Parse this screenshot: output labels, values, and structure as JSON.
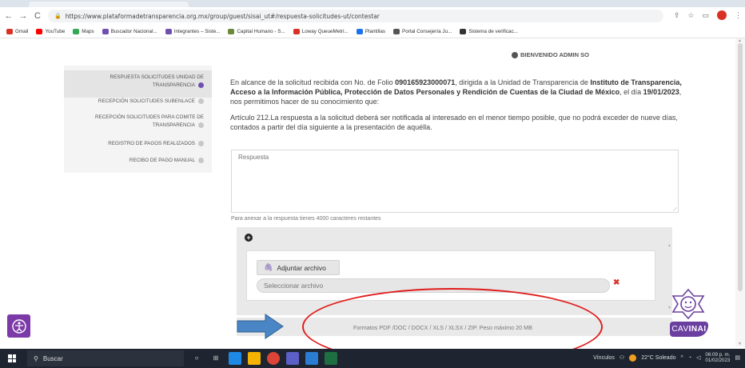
{
  "browser": {
    "url": "https://www.plataformadetransparencia.org.mx/group/guest/sisai_ut#/respuesta-solicitudes-ut/contestar",
    "bookmarks": [
      {
        "label": "Gmail",
        "color": "#d93025"
      },
      {
        "label": "YouTube",
        "color": "#ff0000"
      },
      {
        "label": "Maps",
        "color": "#34a853"
      },
      {
        "label": "Buscador Nacional...",
        "color": "#6f4fb0"
      },
      {
        "label": "Integrantes – Siste...",
        "color": "#6f4fb0"
      },
      {
        "label": "Capital Humano - S...",
        "color": "#6a8a3a"
      },
      {
        "label": "Loway QueueMetri...",
        "color": "#d93025"
      },
      {
        "label": "Plantillas",
        "color": "#1a73e8"
      },
      {
        "label": "Portal Consejería Ju...",
        "color": "#555555"
      },
      {
        "label": "Sistema de verificac...",
        "color": "#333333"
      }
    ]
  },
  "header": {
    "welcome": "BIENVENIDO ADMIN SO"
  },
  "sidebar": {
    "items": [
      {
        "label_line1": "RESPUESTA SOLICITUDES UNIDAD DE",
        "label_line2": "TRANSPARENCIA"
      },
      {
        "label_line1": "RECEPCIÓN SOLICITUDES SUBENLACE",
        "label_line2": ""
      },
      {
        "label_line1": "RECEPCIÓN SOLICITUDES PARA COMITE DE",
        "label_line2": "TRANSPARENCIA"
      },
      {
        "label_line1": "REGISTRO DE PAGOS REALIZADOS",
        "label_line2": ""
      },
      {
        "label_line1": "RECIBO DE PAGO MANUAL",
        "label_line2": ""
      }
    ]
  },
  "content": {
    "p1_a": "En alcance de la solicitud recibida con No. de Folio ",
    "folio": "090165923000071",
    "p1_b": ", dirigida a la Unidad de Transparencia de ",
    "institution": "Instituto de Transparencia, Acceso a la Información Pública, Protección de Datos Personales y Rendición de Cuentas de la Ciudad de México",
    "p1_c": ", el día ",
    "date": "19/01/2023",
    "p1_d": ", nos permitimos hacer de su conocimiento que:",
    "p2": "Artículo 212.La respuesta a la solicitud deberá ser notificada al interesado en el menor tiempo posible, que no podrá exceder de nueve días, contados a partir del día siguiente a la presentación de aquélla.",
    "response_placeholder": "Respuesta",
    "char_hint": "Para anexar a la respuesta tienes 4000 caracteres restantes"
  },
  "attachments": {
    "add_label": "Adjuntar archivo",
    "select_placeholder": "Seleccionar archivo",
    "formats": "Formatos PDF /DOC / DOCX / XLS / XLSX / ZIP. Peso máximo 20 MB"
  },
  "cavinai": {
    "label_a": "CAV",
    "label_b": "INAI"
  },
  "taskbar": {
    "search": "Buscar",
    "links": "Vínculos",
    "weather": "22°C Soleado",
    "time": "06:09 p. m.",
    "date": "01/02/2023"
  }
}
